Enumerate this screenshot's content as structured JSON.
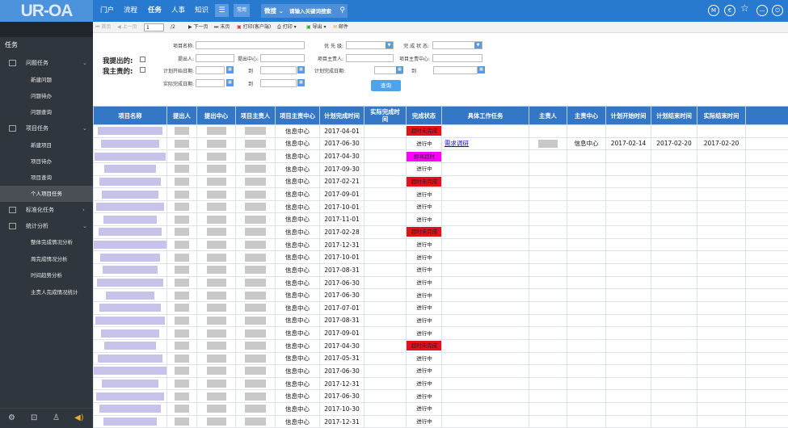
{
  "app": {
    "logo": "UR-OA"
  },
  "topnav": {
    "items": [
      {
        "label": "门户",
        "active": false
      },
      {
        "label": "流程",
        "active": false
      },
      {
        "label": "任务",
        "active": true
      },
      {
        "label": "人事",
        "active": false
      },
      {
        "label": "知识",
        "active": false
      }
    ],
    "menu_icon": "list-icon",
    "common_label": "常用",
    "search_type": "微搜",
    "search_placeholder": "请输入关键词搜索",
    "right_icons": [
      {
        "name": "m-circle-icon",
        "glyph": "M"
      },
      {
        "name": "euro-circle-icon",
        "glyph": "€"
      },
      {
        "name": "star-icon",
        "glyph": "☆"
      },
      {
        "name": "minus-circle-icon",
        "glyph": "—"
      },
      {
        "name": "power-icon",
        "glyph": "⏻"
      }
    ]
  },
  "sidebar": {
    "title": "任务",
    "groups": [
      {
        "label": "问题任务",
        "items": [
          "新建问题",
          "问题待办",
          "问题查询"
        ]
      },
      {
        "label": "项目任务",
        "items": [
          "新建项目",
          "项目待办",
          "项目查询",
          "个人项目任务"
        ]
      },
      {
        "label": "标准化任务",
        "items": []
      },
      {
        "label": "统计分析",
        "items": [
          "整体完成情况分析",
          "周完成情况分析",
          "时间趋势分析",
          "主责人完成情况统计"
        ]
      }
    ],
    "active_item": "个人项目任务"
  },
  "toolbar": {
    "first": "首页",
    "prev": "上一页",
    "page_value": "1",
    "page_total": "/2",
    "next": "下一页",
    "last": "末页",
    "print_client": "打印(客户端)",
    "print": "打印",
    "export": "导出",
    "mail": "邮件"
  },
  "filter": {
    "mine_submitted": "我提出的:",
    "mine_responsible": "我主责的:",
    "project_name_label": "项目名称:",
    "submitter_label": "提出人:",
    "submit_center_label": "提出中心:",
    "plan_start_label": "计划开始日期:",
    "actual_finish_label": "实际完成日期:",
    "to_label": "到",
    "priority_label": "优 先 级:",
    "project_owner_label": "项目主责人:",
    "plan_finish_label": "计划完成日期:",
    "status_label": "完 成 状 态:",
    "owner_center_label": "项目主责中心:",
    "query_button": "查询"
  },
  "table": {
    "columns": [
      "项目名称",
      "提出人",
      "提出中心",
      "项目主责人",
      "项目主责中心",
      "计划完成时间",
      "实际完成时间",
      "完成状态",
      "具体工作任务",
      "主责人",
      "主责中心",
      "计划开始时间",
      "计划结束时间",
      "实际结束时间"
    ],
    "rows": [
      {
        "center": "信息中心",
        "plan": "2017-04-01",
        "status": "超时未完成",
        "color": "red"
      },
      {
        "center": "信息中心",
        "plan": "2017-06-30",
        "status": "进行中",
        "color": "none",
        "task": "需求调研",
        "task_center": "信息中心",
        "t_start": "2017-02-14",
        "t_end": "2017-02-20",
        "t_actual": "2017-02-20"
      },
      {
        "center": "信息中心",
        "plan": "2017-04-30",
        "status": "即将超时",
        "color": "magenta"
      },
      {
        "center": "信息中心",
        "plan": "2017-09-30",
        "status": "进行中",
        "color": "none"
      },
      {
        "center": "信息中心",
        "plan": "2017-02-21",
        "status": "超时未完成",
        "color": "red"
      },
      {
        "center": "信息中心",
        "plan": "2017-09-01",
        "status": "进行中",
        "color": "none"
      },
      {
        "center": "信息中心",
        "plan": "2017-10-01",
        "status": "进行中",
        "color": "none"
      },
      {
        "center": "信息中心",
        "plan": "2017-11-01",
        "status": "进行中",
        "color": "none"
      },
      {
        "center": "信息中心",
        "plan": "2017-02-28",
        "status": "超时未完成",
        "color": "red"
      },
      {
        "center": "信息中心",
        "plan": "2017-12-31",
        "status": "进行中",
        "color": "none"
      },
      {
        "center": "信息中心",
        "plan": "2017-10-01",
        "status": "进行中",
        "color": "none"
      },
      {
        "center": "信息中心",
        "plan": "2017-08-31",
        "status": "进行中",
        "color": "none"
      },
      {
        "center": "信息中心",
        "plan": "2017-06-30",
        "status": "进行中",
        "color": "none"
      },
      {
        "center": "信息中心",
        "plan": "2017-06-30",
        "status": "进行中",
        "color": "none"
      },
      {
        "center": "信息中心",
        "plan": "2017-07-01",
        "status": "进行中",
        "color": "none"
      },
      {
        "center": "信息中心",
        "plan": "2017-08-31",
        "status": "进行中",
        "color": "none"
      },
      {
        "center": "信息中心",
        "plan": "2017-09-01",
        "status": "进行中",
        "color": "none"
      },
      {
        "center": "信息中心",
        "plan": "2017-04-30",
        "status": "超时未完成",
        "color": "red"
      },
      {
        "center": "信息中心",
        "plan": "2017-05-31",
        "status": "进行中",
        "color": "none"
      },
      {
        "center": "信息中心",
        "plan": "2017-06-30",
        "status": "进行中",
        "color": "none"
      },
      {
        "center": "信息中心",
        "plan": "2017-12-31",
        "status": "进行中",
        "color": "none"
      },
      {
        "center": "信息中心",
        "plan": "2017-06-30",
        "status": "进行中",
        "color": "none"
      },
      {
        "center": "信息中心",
        "plan": "2017-10-30",
        "status": "进行中",
        "color": "none"
      },
      {
        "center": "信息中心",
        "plan": "2017-12-31",
        "status": "进行中",
        "color": "none"
      }
    ]
  },
  "colors": {
    "topbar": "#2879d0",
    "sidebar": "#30363d",
    "header": "#3577c7",
    "overdue": "#e6101b",
    "near_due": "#ff00ff"
  }
}
